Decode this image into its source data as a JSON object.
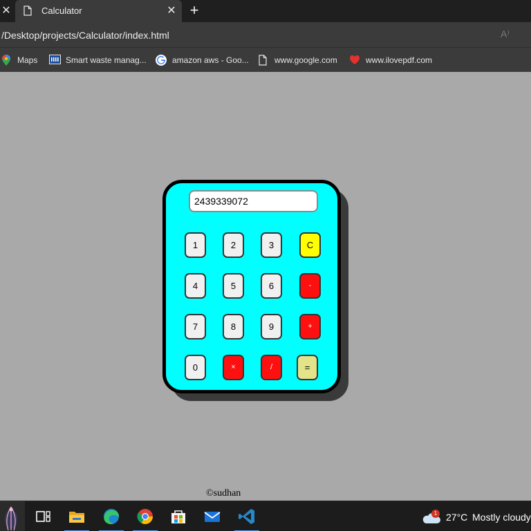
{
  "browser": {
    "tab_title": "Calculator",
    "tab_close_glyph": "✕",
    "new_tab_glyph": "+",
    "url": "/Desktop/projects/Calculator/index.html",
    "read_aloud_glyph": "A⁾"
  },
  "bookmarks": [
    {
      "label": "Maps",
      "icon": "maps-pin-icon"
    },
    {
      "label": "Smart waste manag...",
      "icon": "ieee-icon"
    },
    {
      "label": "amazon aws - Goo...",
      "icon": "google-icon"
    },
    {
      "label": "www.google.com",
      "icon": "page-icon"
    },
    {
      "label": "www.ilovepdf.com",
      "icon": "heart-icon"
    }
  ],
  "calculator": {
    "display_value": "2439339072",
    "keys": [
      {
        "label": "1",
        "kind": "num"
      },
      {
        "label": "2",
        "kind": "num"
      },
      {
        "label": "3",
        "kind": "num"
      },
      {
        "label": "C",
        "kind": "clear"
      },
      {
        "label": "4",
        "kind": "num"
      },
      {
        "label": "5",
        "kind": "num"
      },
      {
        "label": "6",
        "kind": "num"
      },
      {
        "label": "-",
        "kind": "op"
      },
      {
        "label": "7",
        "kind": "num"
      },
      {
        "label": "8",
        "kind": "num"
      },
      {
        "label": "9",
        "kind": "num"
      },
      {
        "label": "+",
        "kind": "op"
      },
      {
        "label": "0",
        "kind": "num"
      },
      {
        "label": "×",
        "kind": "op"
      },
      {
        "label": "/",
        "kind": "op"
      },
      {
        "label": "=",
        "kind": "eq"
      }
    ],
    "colors": {
      "body": "#00ffff",
      "clear": "#ffff00",
      "operator": "#ff1010",
      "equals": "#e3e38a",
      "number": "#f0f0f0"
    }
  },
  "footer": {
    "text": "©sudhan"
  },
  "taskbar": {
    "apps": [
      "start-icon",
      "task-view-icon",
      "file-explorer-icon",
      "edge-icon",
      "chrome-icon",
      "store-icon",
      "mail-icon",
      "vscode-icon"
    ],
    "weather": {
      "temp": "27°C",
      "desc": "Mostly cloudy",
      "badge": "1"
    }
  }
}
